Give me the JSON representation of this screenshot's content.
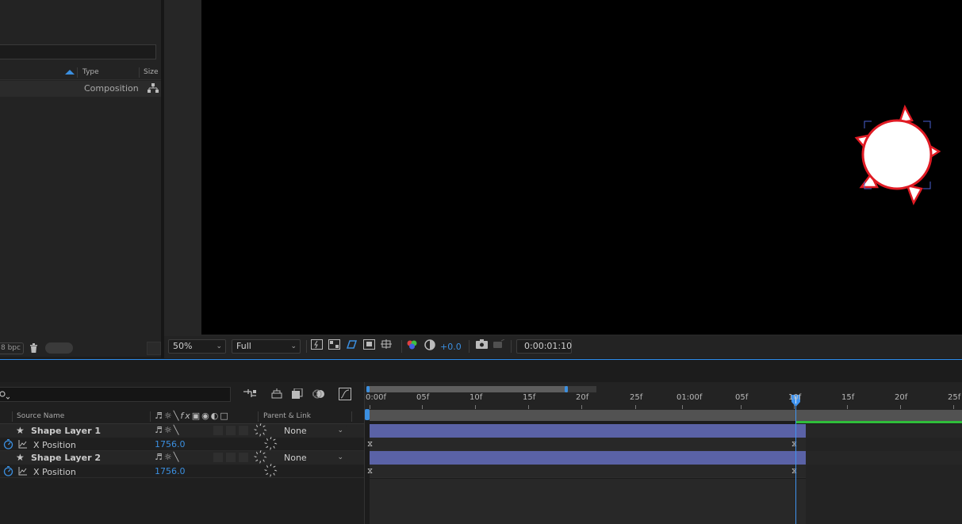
{
  "project_panel": {
    "col_type": "Type",
    "col_size": "Size",
    "item_type": "Composition",
    "bpc_label": "8 bpc"
  },
  "viewer_toolbar": {
    "zoom": "50%",
    "resolution": "Full",
    "exposure": "+0.0",
    "timecode": "0:00:01:10"
  },
  "timeline": {
    "col_source_name": "Source Name",
    "col_parent_link": "Parent & Link",
    "layers": [
      {
        "name": "Shape Layer 1",
        "parent": "None",
        "prop_name": "X Position",
        "prop_value": "1756.0"
      },
      {
        "name": "Shape Layer 2",
        "parent": "None",
        "prop_name": "X Position",
        "prop_value": "1756.0"
      }
    ],
    "ruler_labels": [
      "0:00f",
      "05f",
      "10f",
      "15f",
      "20f",
      "25f",
      "01:00f",
      "05f",
      "10f",
      "15f",
      "20f",
      "25f"
    ]
  },
  "colors": {
    "accent": "#2d8ceb",
    "layer_bar": "#5a62a6",
    "shape_stroke": "#e01b24"
  }
}
